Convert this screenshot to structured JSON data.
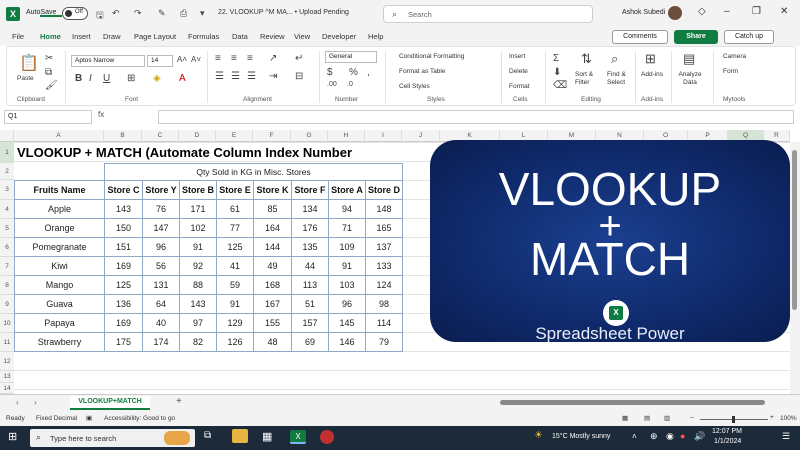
{
  "titlebar": {
    "app_icon": "X",
    "autosave_label": "AutoSave",
    "autosave_state": "Off",
    "doc_title": "22. VLOOKUP ^M MA... • Upload Pending",
    "search_placeholder": "Search",
    "user_name": "Ashok Subedi"
  },
  "tabs": [
    "File",
    "Home",
    "Insert",
    "Draw",
    "Page Layout",
    "Formulas",
    "Data",
    "Review",
    "View",
    "Developer",
    "Help"
  ],
  "actions": {
    "comments": "Comments",
    "share": "Share",
    "catchup": "Catch up"
  },
  "ribbon": {
    "clipboard": {
      "label": "Clipboard",
      "paste": "Paste"
    },
    "font": {
      "label": "Font",
      "name": "Aptos Narrow",
      "size": "14"
    },
    "alignment": {
      "label": "Alignment"
    },
    "number": {
      "label": "Number",
      "format": "General"
    },
    "styles": {
      "label": "Styles",
      "cond": "Conditional Formatting",
      "table": "Format as Table",
      "cell": "Cell Styles"
    },
    "cells": {
      "label": "Cells",
      "insert": "Insert",
      "delete": "Delete",
      "format": "Format"
    },
    "editing": {
      "label": "Editing",
      "sort": "Sort & Filter",
      "find": "Find & Select"
    },
    "addins": {
      "label": "Add-ins",
      "btn": "Add-ins"
    },
    "analyze": {
      "btn": "Analyze Data"
    },
    "mytools": {
      "label": "Mytools",
      "camera": "Camera",
      "form": "Form"
    }
  },
  "formula_bar": {
    "name_box": "Q1",
    "fx": "fx",
    "value": ""
  },
  "columns": [
    "A",
    "B",
    "C",
    "D",
    "E",
    "F",
    "G",
    "H",
    "I",
    "J",
    "K",
    "L",
    "M",
    "N",
    "O",
    "P",
    "Q",
    "R"
  ],
  "rows": [
    "1",
    "2",
    "3",
    "4",
    "5",
    "6",
    "7",
    "8",
    "9",
    "10",
    "11",
    "12",
    "13",
    "14"
  ],
  "sheet": {
    "title": "VLOOKUP + MATCH (Automate Column Index Number",
    "subheader": "Qty Sold in KG in Misc. Stores",
    "headers": [
      "Fruits Name",
      "Store C",
      "Store Y",
      "Store B",
      "Store E",
      "Store K",
      "Store F",
      "Store A",
      "Store D"
    ],
    "rows": [
      [
        "Apple",
        "143",
        "76",
        "171",
        "61",
        "85",
        "134",
        "94",
        "148"
      ],
      [
        "Orange",
        "150",
        "147",
        "102",
        "77",
        "164",
        "176",
        "71",
        "165"
      ],
      [
        "Pomegranate",
        "151",
        "96",
        "91",
        "125",
        "144",
        "135",
        "109",
        "137"
      ],
      [
        "Kiwi",
        "169",
        "56",
        "92",
        "41",
        "49",
        "44",
        "91",
        "133"
      ],
      [
        "Mango",
        "125",
        "131",
        "88",
        "59",
        "168",
        "113",
        "103",
        "124"
      ],
      [
        "Guava",
        "136",
        "64",
        "143",
        "91",
        "167",
        "51",
        "96",
        "98"
      ],
      [
        "Papaya",
        "169",
        "40",
        "97",
        "129",
        "155",
        "157",
        "145",
        "114"
      ],
      [
        "Strawberry",
        "175",
        "174",
        "82",
        "126",
        "48",
        "69",
        "146",
        "79"
      ]
    ]
  },
  "card": {
    "line1": "VLOOKUP",
    "line2": "+",
    "line3": "MATCH",
    "brand": "Spreadsheet Power",
    "logo": "X"
  },
  "sheet_tabs": {
    "active": "VLOOKUP+MATCH",
    "add": "+"
  },
  "status": {
    "ready": "Ready",
    "fixed": "Fixed Decimal",
    "accessibility": "Accessibility: Good to go",
    "zoom": "100%"
  },
  "taskbar": {
    "search": "Type here to search",
    "weather": "15°C  Mostly sunny",
    "time": "12:07 PM",
    "date": "1/1/2024"
  },
  "colors": {
    "excel_green": "#107c41",
    "card_blue": "#0f2a6b",
    "table_border": "#8ea9c8"
  }
}
